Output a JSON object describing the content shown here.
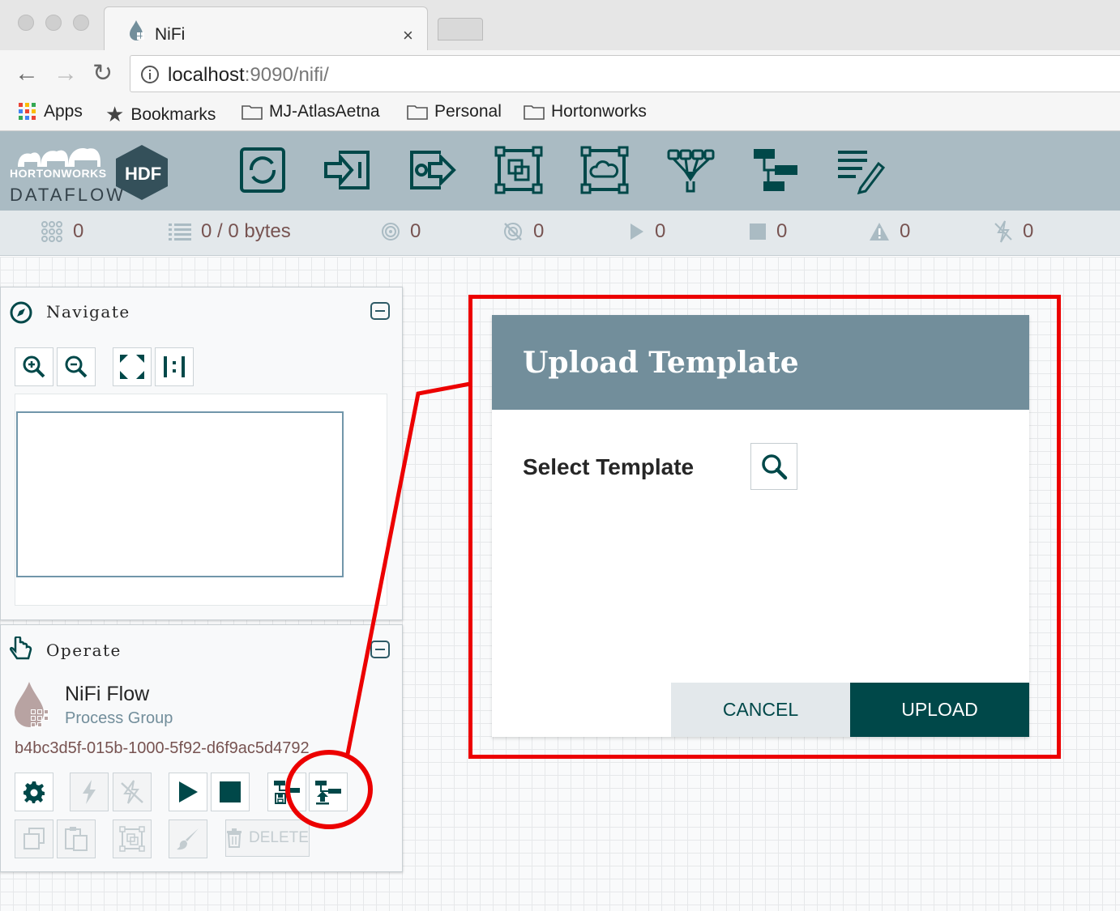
{
  "browser": {
    "tab_title": "NiFi",
    "tab_close": "×",
    "url_host": "localhost",
    "url_rest": ":9090/nifi/",
    "bookmarks": [
      "Apps",
      "Bookmarks",
      "MJ-AtlasAetna",
      "Personal",
      "Hortonworks"
    ]
  },
  "brand": {
    "company": "HORTONWORKS",
    "product": "DATAFLOW",
    "badge": "HDF"
  },
  "status": {
    "active_threads": "0",
    "queued": "0 / 0 bytes",
    "transmitting": "0",
    "not_transmitting": "0",
    "running": "0",
    "stopped": "0",
    "invalid": "0",
    "disabled": "0"
  },
  "navigate": {
    "title": "Navigate"
  },
  "operate": {
    "title": "Operate",
    "name": "NiFi Flow",
    "type": "Process Group",
    "id": "b4bc3d5f-015b-1000-5f92-d6f9ac5d4792",
    "delete_label": "DELETE"
  },
  "dialog": {
    "title": "Upload Template",
    "select_label": "Select Template",
    "cancel_label": "CANCEL",
    "upload_label": "UPLOAD"
  },
  "colors": {
    "header": "#aabbc3",
    "dialog_header": "#728e9b",
    "primary": "#004849",
    "highlight": "#ec0000"
  }
}
